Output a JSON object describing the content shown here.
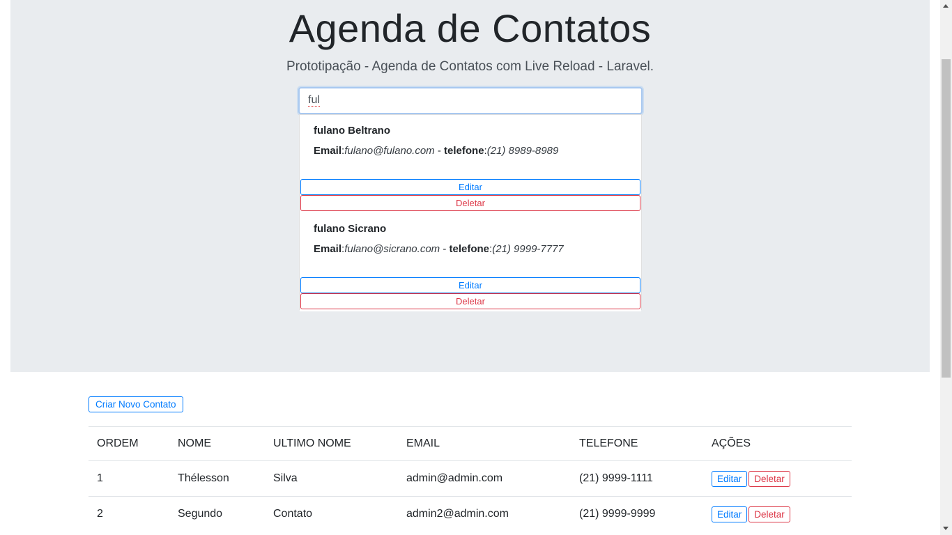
{
  "header": {
    "title": "Agenda de Contatos",
    "subtitle": "Prototipação - Agenda de Contatos com Live Reload - Laravel."
  },
  "search": {
    "value": "ful"
  },
  "results": [
    {
      "name": "fulano Beltrano",
      "email_label": "Email",
      "email": "fulano@fulano.com",
      "separator": "-",
      "phone_label": "telefone",
      "phone": "(21) 8989-8989",
      "edit_label": "Editar",
      "delete_label": "Deletar"
    },
    {
      "name": "fulano Sicrano",
      "email_label": "Email",
      "email": "fulano@sicrano.com",
      "separator": "-",
      "phone_label": "telefone",
      "phone": "(21) 9999-7777",
      "edit_label": "Editar",
      "delete_label": "Deletar"
    }
  ],
  "create_button": "Criar Novo Contato",
  "table": {
    "headers": [
      "ORDEM",
      "NOME",
      "ULTIMO NOME",
      "EMAIL",
      "TELEFONE",
      "AÇÕES"
    ],
    "rows": [
      {
        "ordem": "1",
        "nome": "Thélesson",
        "ultimo_nome": "Silva",
        "email": "admin@admin.com",
        "telefone": "(21) 9999-1111",
        "edit_label": "Editar",
        "delete_label": "Deletar"
      },
      {
        "ordem": "2",
        "nome": "Segundo",
        "ultimo_nome": "Contato",
        "email": "admin2@admin.com",
        "telefone": "(21) 9999-9999",
        "edit_label": "Editar",
        "delete_label": "Deletar"
      }
    ]
  },
  "colors": {
    "primary": "#007bff",
    "danger": "#dc3545",
    "jumbotron": "#e9ecef"
  }
}
